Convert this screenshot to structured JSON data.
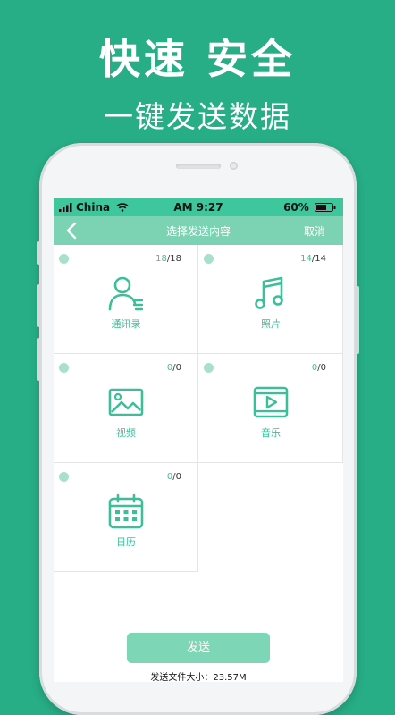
{
  "promo": {
    "title": "快速 安全",
    "subtitle": "一键发送数据"
  },
  "status_bar": {
    "carrier": "China",
    "time": "AM 9:27",
    "battery": "60%"
  },
  "nav": {
    "title": "选择发送内容",
    "cancel": "取消",
    "back_icon": "chevron-left-icon"
  },
  "categories": [
    {
      "label": "通讯录",
      "selected": "18",
      "total": "/18",
      "icon": "contacts-icon"
    },
    {
      "label": "照片",
      "selected": "14",
      "total": "/14",
      "icon": "music-note-icon"
    },
    {
      "label": "视频",
      "selected": "0",
      "total": "/0",
      "icon": "image-icon"
    },
    {
      "label": "音乐",
      "selected": "0",
      "total": "/0",
      "icon": "play-video-icon"
    },
    {
      "label": "日历",
      "selected": "0",
      "total": "/0",
      "icon": "calendar-icon"
    }
  ],
  "footer": {
    "send_label": "发送",
    "size_text": "发送文件大小：23.57M"
  },
  "colors": {
    "background": "#27ae86",
    "accent": "#3ec79d",
    "nav": "#7bd3b3"
  }
}
